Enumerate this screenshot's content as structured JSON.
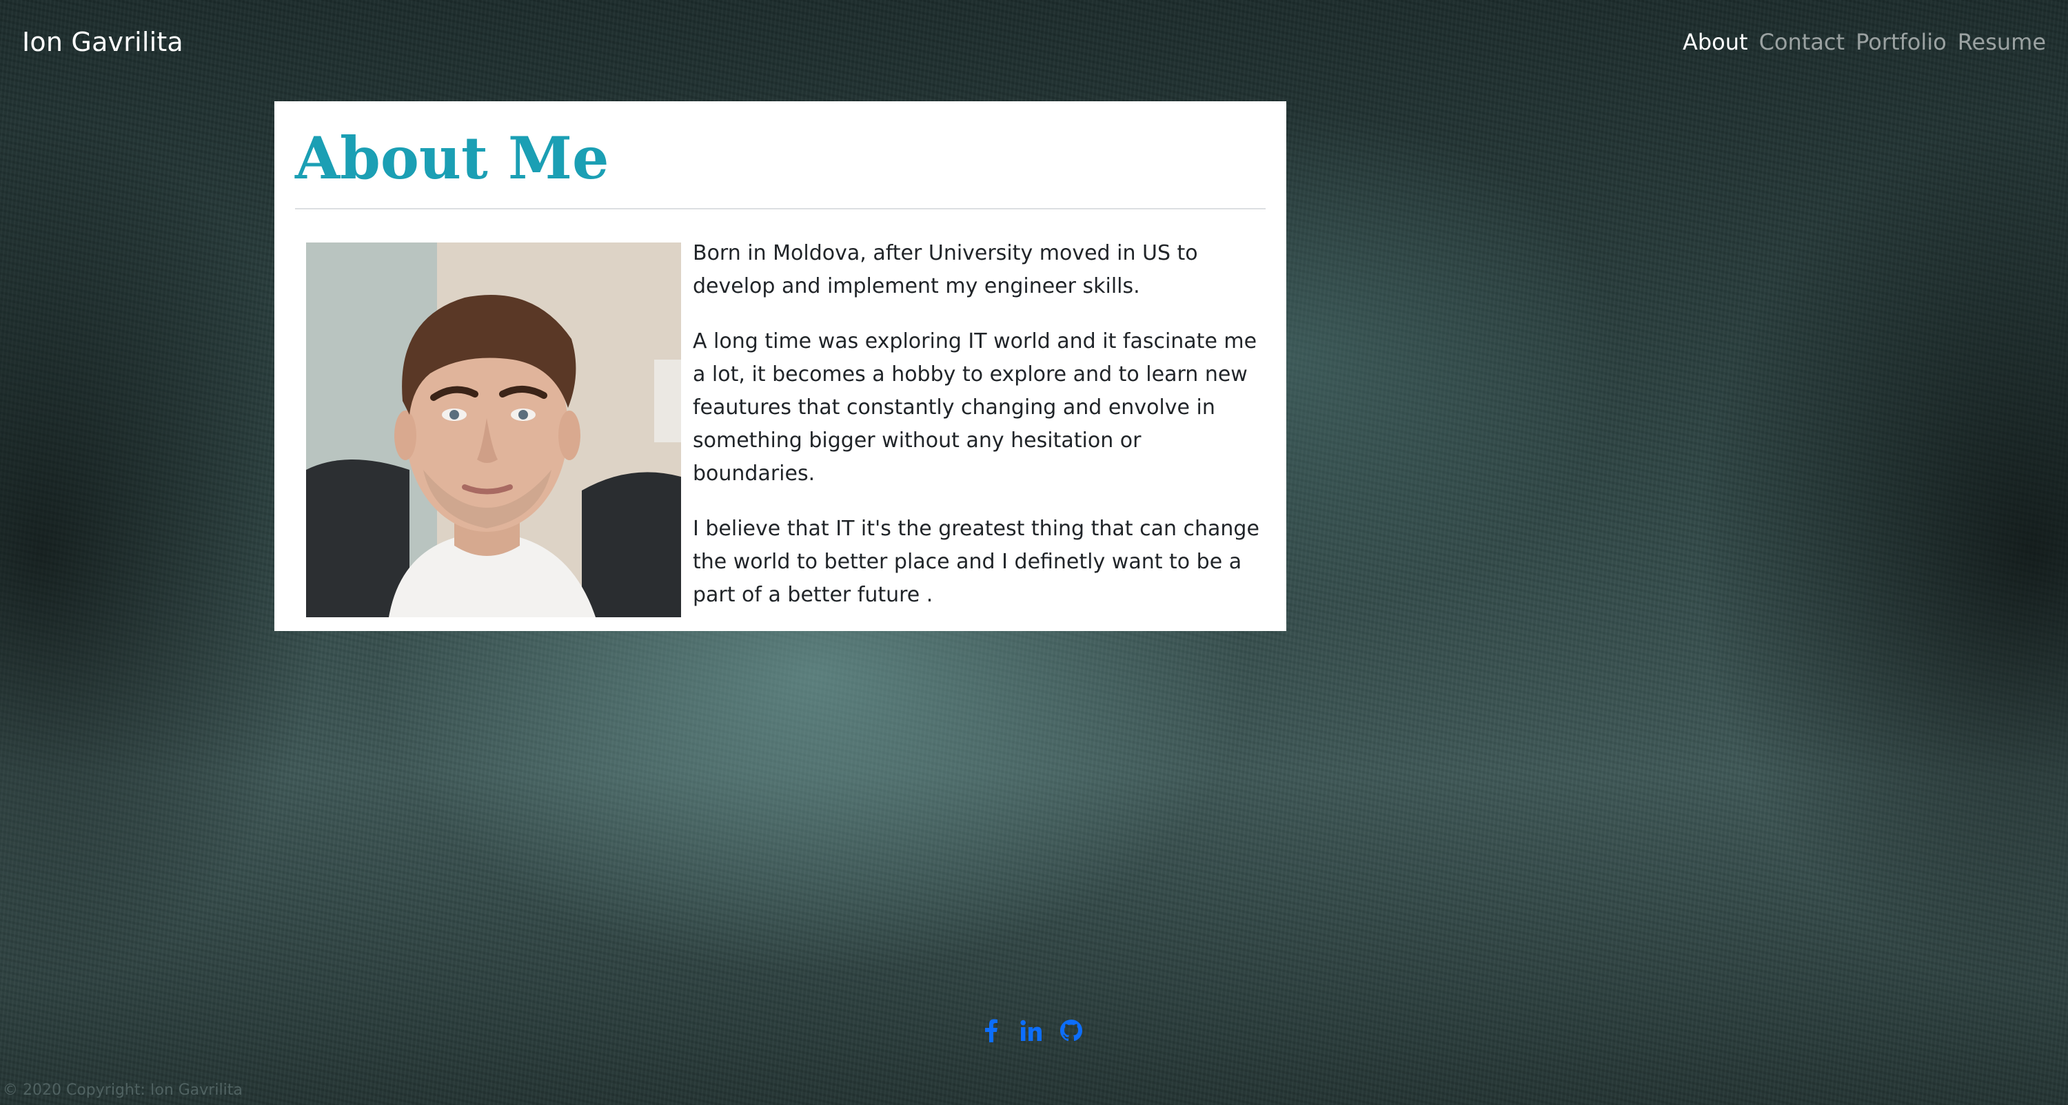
{
  "navbar": {
    "brand": "Ion Gavrilita",
    "links": [
      {
        "label": "About",
        "active": true
      },
      {
        "label": "Contact",
        "active": false
      },
      {
        "label": "Portfolio",
        "active": false
      },
      {
        "label": "Resume",
        "active": false
      }
    ]
  },
  "about": {
    "title": "About Me",
    "paragraphs": [
      "Born in Moldova, after University moved in US to develop and implement my engineer skills.",
      "A long time was exploring IT world and it fascinate me a lot, it becomes a hobby to explore and to learn new feautures that constantly changing and envolve in something bigger without any hesitation or boundaries.",
      "I believe that IT it's the greatest thing that can change the world to better place and I definetly want to be a part of a better future ."
    ]
  },
  "social": {
    "icons": [
      "facebook-icon",
      "linkedin-icon",
      "github-icon"
    ],
    "color": "#0d6efd"
  },
  "footer": {
    "text": "© 2020 Copyright: Ion Gavrilita"
  },
  "colors": {
    "accent": "#1b9fb4",
    "card_bg": "#ffffff"
  }
}
